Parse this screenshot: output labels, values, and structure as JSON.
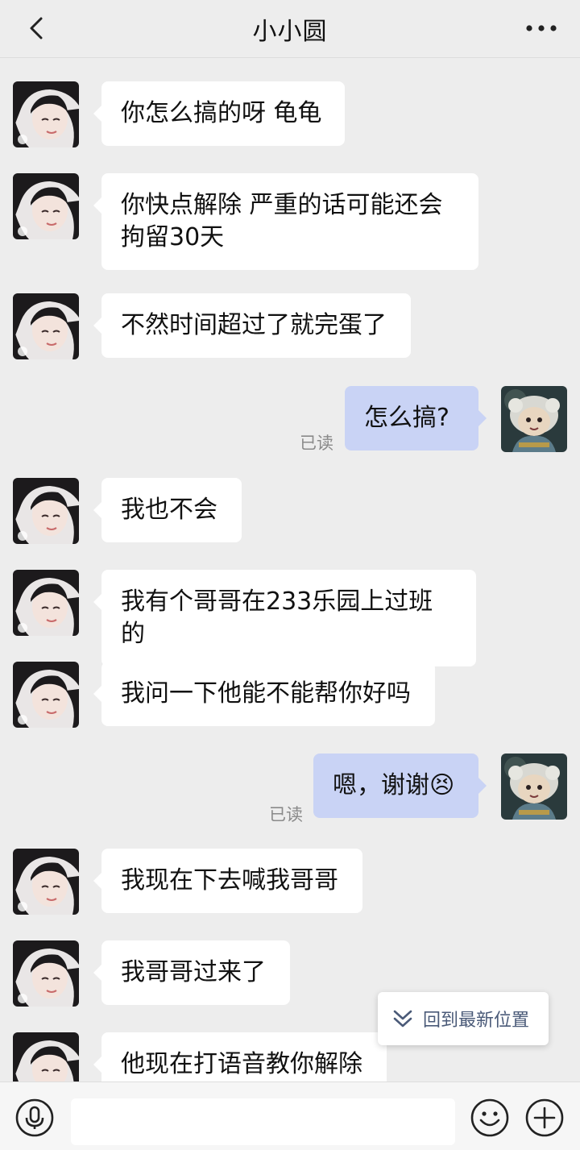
{
  "header": {
    "title": "小小圆",
    "back_icon": "chevron-left-icon",
    "more_icon": "more-horizontal-icon"
  },
  "messages": [
    {
      "side": "left",
      "text": "你怎么搞的呀 龟龟"
    },
    {
      "side": "left",
      "text": "你快点解除 严重的话可能还会拘留30天"
    },
    {
      "side": "left",
      "text": "不然时间超过了就完蛋了"
    },
    {
      "side": "right",
      "text": "怎么搞?",
      "status": "已读"
    },
    {
      "side": "left",
      "text": "我也不会"
    },
    {
      "side": "left",
      "text": "我有个哥哥在233乐园上过班的"
    },
    {
      "side": "left",
      "text": "我问一下他能不能帮你好吗"
    },
    {
      "side": "right",
      "text": "嗯，谢谢😣",
      "status": "已读"
    },
    {
      "side": "left",
      "text": "我现在下去喊我哥哥"
    },
    {
      "side": "left",
      "text": "我哥哥过来了"
    },
    {
      "side": "left",
      "text": "他现在打语音教你解除"
    }
  ],
  "jump_to_latest": {
    "label": "回到最新位置",
    "icon": "double-chevron-down-icon"
  },
  "input_bar": {
    "voice_icon": "microphone-icon",
    "input_value": "",
    "emoji_icon": "smiley-icon",
    "plus_icon": "plus-circle-icon"
  },
  "colors": {
    "background": "#ededed",
    "incoming_bubble": "#ffffff",
    "outgoing_bubble": "#c9d3f5",
    "read_status": "#8a8a8a"
  }
}
